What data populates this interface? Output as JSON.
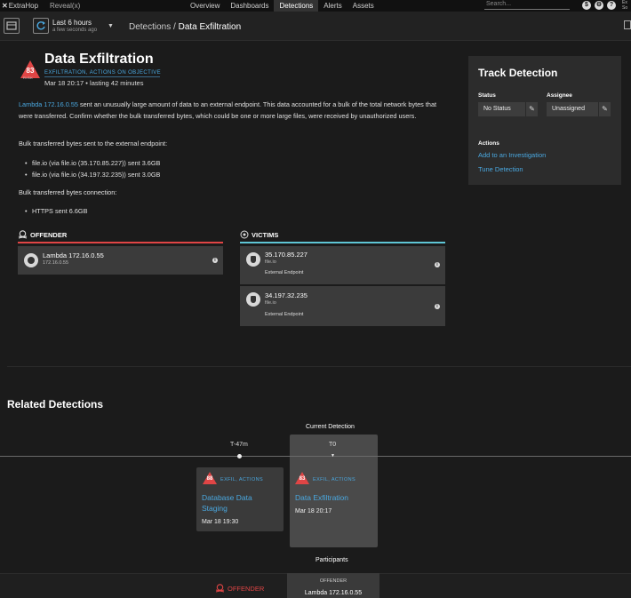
{
  "topnav": {
    "brand": "ExtraHop",
    "product": "Reveal(x)",
    "links": [
      "Overview",
      "Dashboards",
      "Detections",
      "Alerts",
      "Assets"
    ],
    "active": "Detections",
    "search_placeholder": "Search...",
    "user_lines": [
      "Ex",
      "So"
    ]
  },
  "subbar": {
    "time_range": "Last 6 hours",
    "time_sub": "a few seconds ago",
    "breadcrumb_parent": "Detections",
    "breadcrumb_sep": "/",
    "breadcrumb_current": "Data Exfiltration"
  },
  "detection": {
    "risk_score": "83",
    "risk_label": "RISK",
    "title": "Data Exfiltration",
    "categories": "EXFILTRATION, ACTIONS ON OBJECTIVE",
    "date": "Mar 18 20:17",
    "bullet_sep": "•",
    "duration": "lasting 42 minutes",
    "desc_link": "Lambda 172.16.0.55",
    "desc_text": " sent an unusually large amount of data to an external endpoint. This data accounted for a bulk of the total network bytes that were transferred. Confirm whether the bulk transferred bytes, which could be one or more large files, were received by unauthorized users.",
    "sent_heading": "Bulk transferred bytes sent to the external endpoint:",
    "sent_items": [
      "file.io (via file.io (35.170.85.227)) sent 3.6GB",
      "file.io (via file.io (34.197.32.235)) sent 3.0GB"
    ],
    "conn_heading": "Bulk transferred bytes connection:",
    "conn_items": [
      "HTTPS sent 6.6GB"
    ]
  },
  "offender": {
    "heading": "OFFENDER",
    "name": "Lambda 172.16.0.55",
    "ip": "172.16.0.55",
    "color": "#e04545"
  },
  "victims": {
    "heading": "VICTIMS",
    "color": "#5fc6d6",
    "items": [
      {
        "name": "35.170.85.227",
        "host": "file.io",
        "role": "External Endpoint"
      },
      {
        "name": "34.197.32.235",
        "host": "file.io",
        "role": "External Endpoint"
      }
    ]
  },
  "track": {
    "title": "Track Detection",
    "status_label": "Status",
    "status_value": "No Status",
    "assignee_label": "Assignee",
    "assignee_value": "Unassigned",
    "actions_label": "Actions",
    "actions": [
      "Add to an Investigation",
      "Tune Detection"
    ]
  },
  "related": {
    "title": "Related Detections",
    "current_label": "Current Detection",
    "ticks": [
      "T-47m",
      "T0"
    ],
    "cards": [
      {
        "risk": "88",
        "category": "EXFIL, ACTIONS",
        "name_lines": [
          "Database Data",
          "Staging"
        ],
        "date": "Mar 18 19:30"
      },
      {
        "risk": "83",
        "category": "EXFIL, ACTIONS",
        "name_lines": [
          "Data Exfiltration"
        ],
        "date": "Mar 18 20:17"
      }
    ],
    "participants_label": "Participants",
    "bottom_offender_label": "OFFENDER",
    "bottom_card_heading": "OFFENDER",
    "bottom_card_name": "Lambda 172.16.0.55"
  }
}
